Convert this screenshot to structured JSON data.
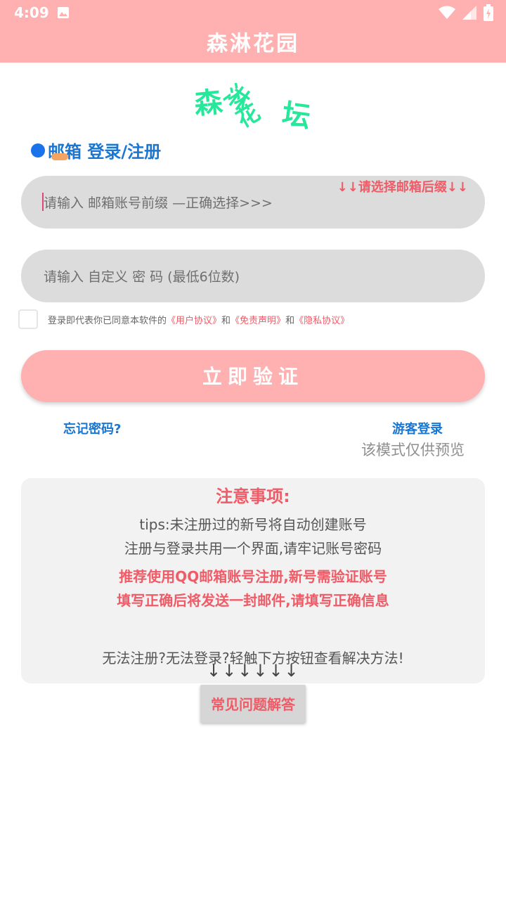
{
  "status_bar": {
    "time": "4:09",
    "icons": [
      "image-icon",
      "wifi-icon",
      "signal-icon",
      "battery-icon"
    ]
  },
  "app_bar": {
    "title": "森淋花园"
  },
  "logo": {
    "chars": [
      "森",
      "淋",
      "花",
      "坛"
    ]
  },
  "login_mode": {
    "label": "邮箱 登录/注册"
  },
  "email_field": {
    "placeholder": "请输入 邮箱账号前缀 —正确选择>>>",
    "suffix_hint": "↓↓请选择邮箱后缀↓↓"
  },
  "password_field": {
    "placeholder": "请输入 自定义 密 码 (最低6位数)"
  },
  "agreement": {
    "prefix": "登录即代表你已同意本软件的",
    "user_agreement": "《用户协议》",
    "and1": "和",
    "disclaimer": "《免责声明》",
    "and2": "和",
    "privacy": "《隐私协议》"
  },
  "verify_button": {
    "label": "立即验证"
  },
  "forgot_password": {
    "label": "忘记密码?"
  },
  "guest_login": {
    "label": "游客登录",
    "note": "该模式仅供预览"
  },
  "notice": {
    "title": "注意事项:",
    "line1": "tips:未注册过的新号将自动创建账号",
    "line2": "注册与登录共用一个界面,请牢记账号密码",
    "red1": "推荐使用QQ邮箱账号注册,新号需验证账号",
    "red2": "填写正确后将发送一封邮件,请填写正确信息",
    "question": "无法注册?无法登录?轻触下方按钮查看解决方法!"
  },
  "arrows": "↓↓↓↓↓↓",
  "faq_button": {
    "label": "常见问题解答"
  },
  "colors": {
    "primary": "#ffb0b0",
    "accent_red": "#ef5b66",
    "link_blue": "#1976d2",
    "logo_green": "#25e89a"
  }
}
